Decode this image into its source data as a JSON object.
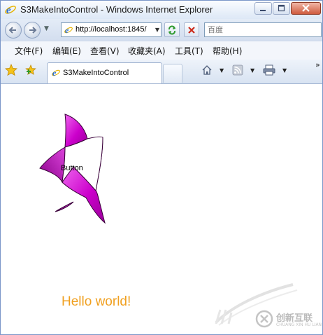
{
  "window": {
    "title": "S3MakeIntoControl - Windows Internet Explorer"
  },
  "address_bar": {
    "url": "http://localhost:1845/",
    "search_placeholder": "百度"
  },
  "menu": {
    "items": [
      {
        "label": "文件(F)"
      },
      {
        "label": "编辑(E)"
      },
      {
        "label": "查看(V)"
      },
      {
        "label": "收藏夹(A)"
      },
      {
        "label": "工具(T)"
      },
      {
        "label": "帮助(H)"
      }
    ]
  },
  "tabs": {
    "active_label": "S3MakeIntoControl"
  },
  "content": {
    "shape_button_label": "Button",
    "hello_text": "Hello world!",
    "accent_color": "#f0a020",
    "shape_color": "#cc00cc"
  },
  "watermark": {
    "brand": "创新互联",
    "sub": "CHUANG XIN HU LIAN"
  }
}
